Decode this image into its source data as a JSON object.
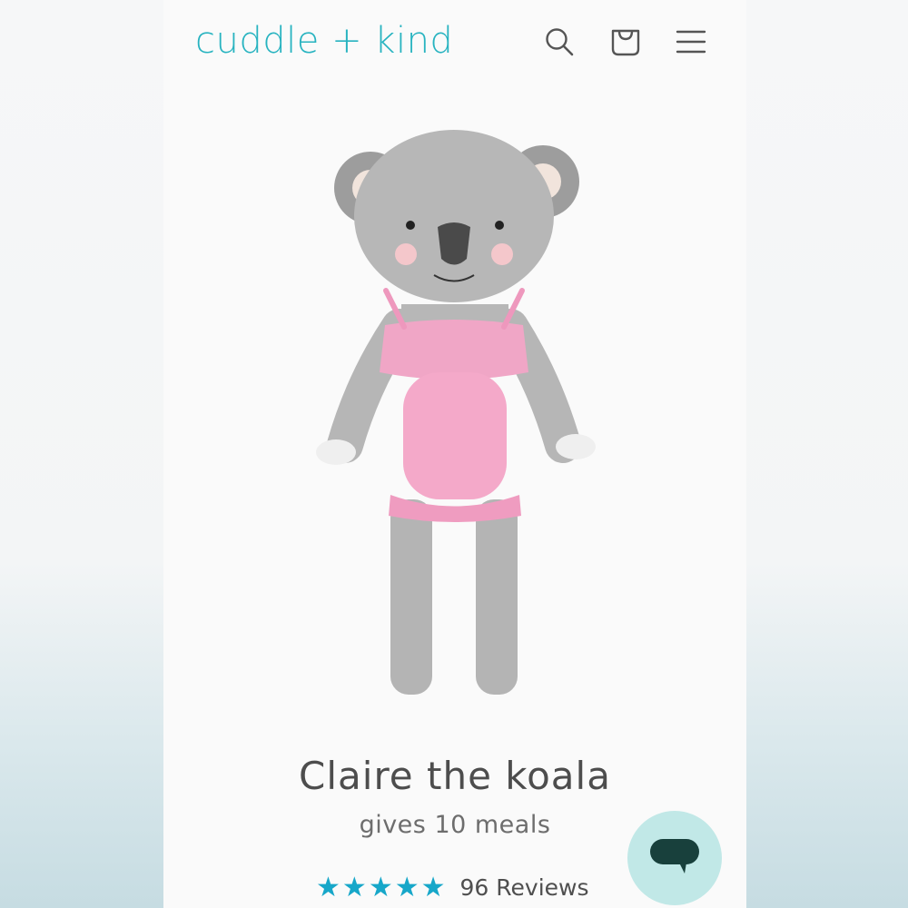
{
  "header": {
    "logo": "cuddle + kind",
    "icons": [
      "search-icon",
      "cart-icon",
      "menu-icon"
    ]
  },
  "product": {
    "image_alt": "knit koala doll in pink romper",
    "title": "Claire the koala",
    "subtitle": "gives 10 meals",
    "rating": 5,
    "reviews_label": "96 Reviews"
  },
  "chat": {
    "icon": "chat-icon"
  },
  "colors": {
    "brand": "#27b3c0",
    "star": "#17a7c9",
    "chat_bg": "#c1e8e7",
    "chat_icon": "#18403c"
  }
}
